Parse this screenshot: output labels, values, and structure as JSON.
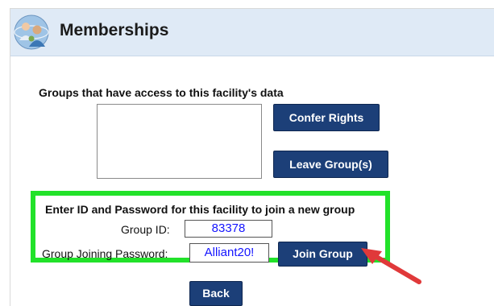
{
  "header": {
    "title": "Memberships",
    "logo_icon": "people-globe-icon"
  },
  "groups": {
    "label": "Groups that have access to this facility's data",
    "items": []
  },
  "buttons": {
    "confer": "Confer Rights",
    "leave": "Leave Group(s)",
    "join": "Join Group",
    "back": "Back"
  },
  "join_form": {
    "instructions": "Enter ID and Password for this facility to join a new group",
    "group_id_label": "Group ID:",
    "group_id_value": "83378",
    "password_label": "Group Joining Password:",
    "password_value": "Alliant20!"
  },
  "annotations": {
    "highlight_color": "#22e22a",
    "arrow_color": "#e0393a",
    "arrow_icon": "pointer-arrow-icon"
  },
  "colors": {
    "header_bg": "#dfeaf6",
    "button_bg": "#1c3f78",
    "input_text": "#1414ff"
  }
}
